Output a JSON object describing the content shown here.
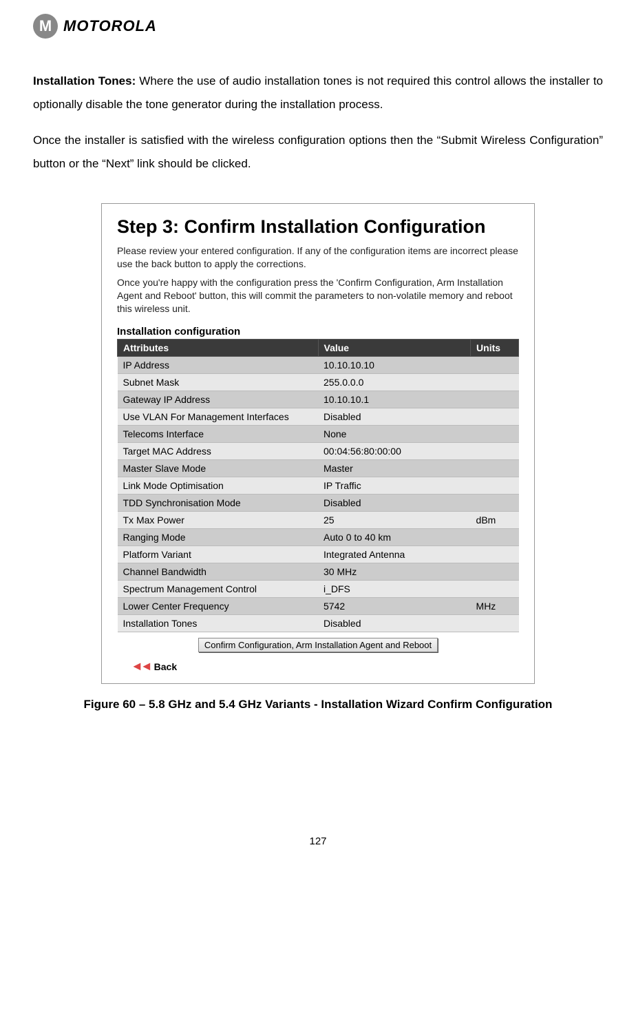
{
  "logo": {
    "mark": "M",
    "brand": "MOTOROLA"
  },
  "p1_label": "Installation Tones:",
  "p1_text": " Where the use of audio installation tones is not required this control allows the installer to optionally disable the tone generator during the installation process.",
  "p2_text": "Once the installer is satisfied with the wireless configuration options then the “Submit Wireless Configuration” button or the “Next” link should be clicked.",
  "screenshot": {
    "title": "Step 3: Confirm Installation Configuration",
    "intro1": "Please review your entered configuration. If any of the configuration items are incorrect please use the back button to apply the corrections.",
    "intro2": "Once you're happy with the configuration press the 'Confirm Configuration, Arm Installation Agent and Reboot' button, this will commit the parameters to non-volatile memory and reboot this wireless unit.",
    "section_heading": "Installation configuration",
    "headers": {
      "attr": "Attributes",
      "value": "Value",
      "units": "Units"
    },
    "rows": [
      {
        "attr": "IP Address",
        "value": "10.10.10.10",
        "units": ""
      },
      {
        "attr": "Subnet Mask",
        "value": "255.0.0.0",
        "units": ""
      },
      {
        "attr": "Gateway IP Address",
        "value": "10.10.10.1",
        "units": ""
      },
      {
        "attr": "Use VLAN For Management Interfaces",
        "value": "Disabled",
        "units": ""
      },
      {
        "attr": "Telecoms Interface",
        "value": "None",
        "units": ""
      },
      {
        "attr": "Target MAC Address",
        "value": "00:04:56:80:00:00",
        "units": ""
      },
      {
        "attr": "Master Slave Mode",
        "value": "Master",
        "units": ""
      },
      {
        "attr": "Link Mode Optimisation",
        "value": "IP Traffic",
        "units": ""
      },
      {
        "attr": "TDD Synchronisation Mode",
        "value": "Disabled",
        "units": ""
      },
      {
        "attr": "Tx Max Power",
        "value": "25",
        "units": "dBm"
      },
      {
        "attr": "Ranging Mode",
        "value": "Auto 0 to 40 km",
        "units": ""
      },
      {
        "attr": "Platform Variant",
        "value": "Integrated Antenna",
        "units": ""
      },
      {
        "attr": "Channel Bandwidth",
        "value": "30 MHz",
        "units": ""
      },
      {
        "attr": "Spectrum Management Control",
        "value": "i_DFS",
        "units": ""
      },
      {
        "attr": "Lower Center Frequency",
        "value": "5742",
        "units": "MHz"
      },
      {
        "attr": "Installation Tones",
        "value": "Disabled",
        "units": ""
      }
    ],
    "confirm_button": "Confirm Configuration, Arm Installation Agent and Reboot",
    "back_label": "Back"
  },
  "figure_caption": "Figure 60 – 5.8 GHz and 5.4 GHz Variants - Installation Wizard Confirm Configuration",
  "page_number": "127"
}
